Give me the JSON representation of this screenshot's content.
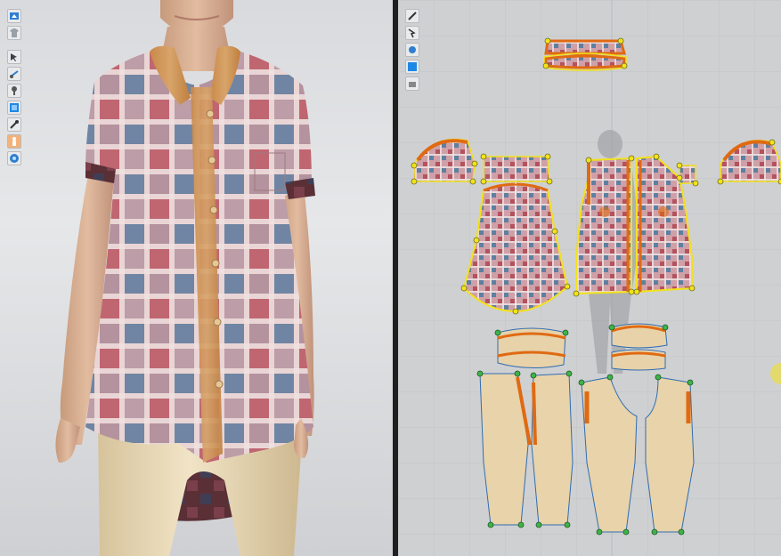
{
  "app": {
    "panels": [
      "3d-garment-window",
      "2d-pattern-window"
    ]
  },
  "toolbar_3d": [
    {
      "icon": "simulation-icon"
    },
    {
      "icon": "garment-icon"
    },
    {
      "icon": "select-move-icon"
    },
    {
      "icon": "fold-icon"
    },
    {
      "icon": "tack-icon"
    },
    {
      "icon": "texture-icon"
    },
    {
      "icon": "pin-icon"
    },
    {
      "icon": "avatar-icon"
    },
    {
      "icon": "render-icon"
    }
  ],
  "toolbar_2d": [
    {
      "icon": "edit-pattern-icon"
    },
    {
      "icon": "transform-pattern-icon"
    },
    {
      "icon": "segment-icon"
    },
    {
      "icon": "texture-icon"
    },
    {
      "icon": "annotation-icon"
    }
  ],
  "colors": {
    "plaid_base": "#c9a0a8",
    "plaid_red": "#b8525e",
    "plaid_blue": "#5e7fa0",
    "placket": "#c98a3a",
    "pants": "#e5d2a8",
    "seam_orange": "#e06a12",
    "selection_yellow": "#f2e21a",
    "pattern_outline_blue": "#3d6fb5"
  }
}
